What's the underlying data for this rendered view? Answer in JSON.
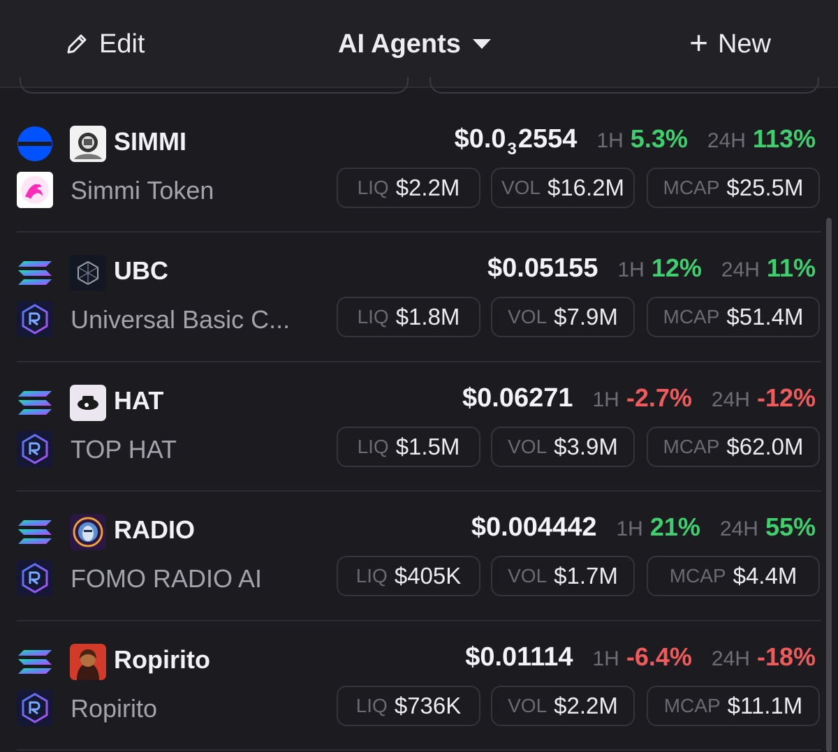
{
  "header": {
    "edit_label": "Edit",
    "title": "AI Agents",
    "new_label": "New",
    "new_icon": "+"
  },
  "labels": {
    "h1": "1H",
    "h24": "24H",
    "liq": "LIQ",
    "vol": "VOL",
    "mcap": "MCAP"
  },
  "colors": {
    "positive": "#3fcf6e",
    "negative": "#ef5b5b",
    "background": "#1c1c20"
  },
  "tokens": [
    {
      "symbol": "SIMMI",
      "name": "Simmi Token",
      "chain_icon": "base-chain-icon",
      "dex_icon": "uniswap-icon",
      "price_main": "$0.0",
      "price_sub": "3",
      "price_tail": "2554",
      "change_1h": "5.3%",
      "change_24h": "113%",
      "liq": "$2.2M",
      "vol": "$16.2M",
      "mcap": "$25.5M"
    },
    {
      "symbol": "UBC",
      "name": "Universal Basic C...",
      "chain_icon": "solana-icon",
      "dex_icon": "raydium-icon",
      "price_main": "$0.05155",
      "change_1h": "12%",
      "change_24h": "11%",
      "liq": "$1.8M",
      "vol": "$7.9M",
      "mcap": "$51.4M"
    },
    {
      "symbol": "HAT",
      "name": "TOP HAT",
      "chain_icon": "solana-icon",
      "dex_icon": "raydium-icon",
      "price_main": "$0.06271",
      "change_1h": "-2.7%",
      "change_24h": "-12%",
      "liq": "$1.5M",
      "vol": "$3.9M",
      "mcap": "$62.0M"
    },
    {
      "symbol": "RADIO",
      "name": "FOMO RADIO AI",
      "chain_icon": "solana-icon",
      "dex_icon": "raydium-icon",
      "price_main": "$0.004442",
      "change_1h": "21%",
      "change_24h": "55%",
      "liq": "$405K",
      "vol": "$1.7M",
      "mcap": "$4.4M"
    },
    {
      "symbol": "Ropirito",
      "name": "Ropirito",
      "chain_icon": "solana-icon",
      "dex_icon": "raydium-icon",
      "price_main": "$0.01114",
      "change_1h": "-6.4%",
      "change_24h": "-18%",
      "liq": "$736K",
      "vol": "$2.2M",
      "mcap": "$11.1M"
    }
  ]
}
